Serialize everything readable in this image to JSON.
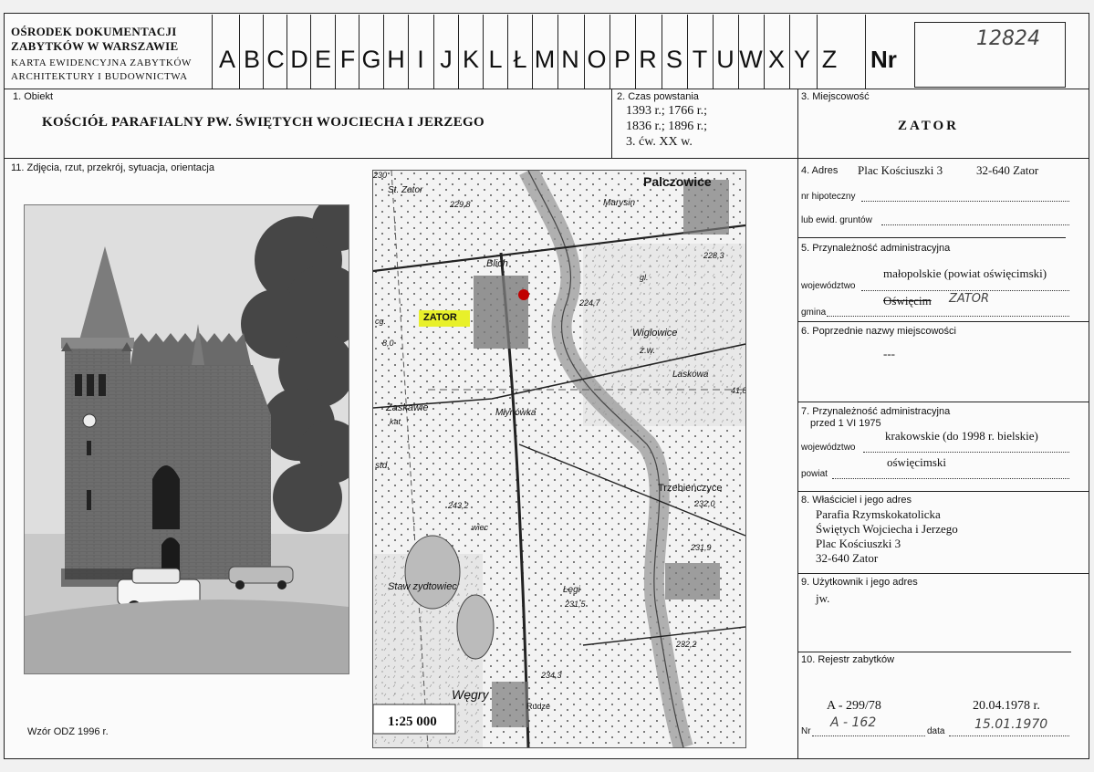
{
  "header": {
    "org_line1": "OŚRODEK DOKUMENTACJI",
    "org_line2": "ZABYTKÓW W WARSZAWIE",
    "card_line1": "KARTA EWIDENCYJNA ZABYTKÓW",
    "card_line2": "ARCHITEKTURY I BUDOWNICTWA",
    "letters": [
      "A",
      "B",
      "C",
      "D",
      "E",
      "F",
      "G",
      "H",
      "I",
      "J",
      "K",
      "L",
      "Ł",
      "M",
      "N",
      "O",
      "P",
      "R",
      "S",
      "T",
      "U",
      "W",
      "X",
      "Y",
      "Z"
    ],
    "nr_label": "Nr",
    "nr_handwritten": "12824"
  },
  "object": {
    "label": "1. Obiekt",
    "name": "KOŚCIÓŁ PARAFIALNY PW. ŚWIĘTYCH WOJCIECHA I JERZEGO"
  },
  "dates": {
    "label": "2. Czas powstania",
    "line1": "1393 r.; 1766 r.;",
    "line2": "1836 r.; 1896 r.;",
    "line3": "3. ćw. XX w."
  },
  "locality": {
    "label": "3. Miejscowość",
    "value": "ZATOR"
  },
  "photos": {
    "label": "11. Zdjęcia, rzut, przekrój, sytuacja, orientacja",
    "scale": "1:25 000",
    "form_version": "Wzór ODZ 1996 r."
  },
  "map": {
    "labels": [
      "Palczowice",
      "Marysin",
      "St. Zator",
      "229,8",
      "Blich",
      "228,3",
      "ZATOR",
      "224,7",
      "Wiglowice",
      "Laskowa",
      "ż.w.",
      "gl.",
      "Młynówka",
      "Trzebieńczyce",
      "232,0",
      "243,2",
      "Staw zydtowiec",
      "Łęgi",
      "231,5",
      "231,9",
      "234,3",
      "232,2",
      "Węgry",
      "Rudze",
      "Zaskawie",
      "kat",
      "std.",
      "wiec",
      "cg.",
      "8,0",
      "41,8",
      "230"
    ]
  },
  "address": {
    "label": "4. Adres",
    "street": "Plac Kościuszki 3",
    "postal": "32-640 Zator",
    "mortgage_label": "nr hipoteczny",
    "land_label": "lub ewid. gruntów"
  },
  "admin": {
    "label": "5. Przynależność administracyjna",
    "province_label": "województwo",
    "province": "małopolskie (powiat oświęcimski)",
    "commune_label": "gmina",
    "commune": "Oświęcim",
    "commune_handwritten": "ZATOR"
  },
  "former_names": {
    "label": "6. Poprzednie nazwy miejscowości",
    "value": "---"
  },
  "admin_before": {
    "label": "7. Przynależność administracyjna",
    "sub": "przed 1 VI 1975",
    "province_label": "województwo",
    "province": "krakowskie (do 1998 r. bielskie)",
    "district_label": "powiat",
    "district": "oświęcimski"
  },
  "owner": {
    "label": "8. Właściciel i jego adres",
    "line1": "Parafia Rzymskokatolicka",
    "line2": "Świętych Wojciecha i Jerzego",
    "line3": "Plac Kościuszki 3",
    "line4": "32-640 Zator"
  },
  "user": {
    "label": "9. Użytkownik i jego adres",
    "value": "jw."
  },
  "register": {
    "label": "10. Rejestr zabytków",
    "nr_value": "A - 299/78",
    "date_value": "20.04.1978 r.",
    "nr_label": "Nr",
    "date_label": "data",
    "nr_handwritten": "A - 162",
    "date_handwritten": "15.01.1970"
  }
}
